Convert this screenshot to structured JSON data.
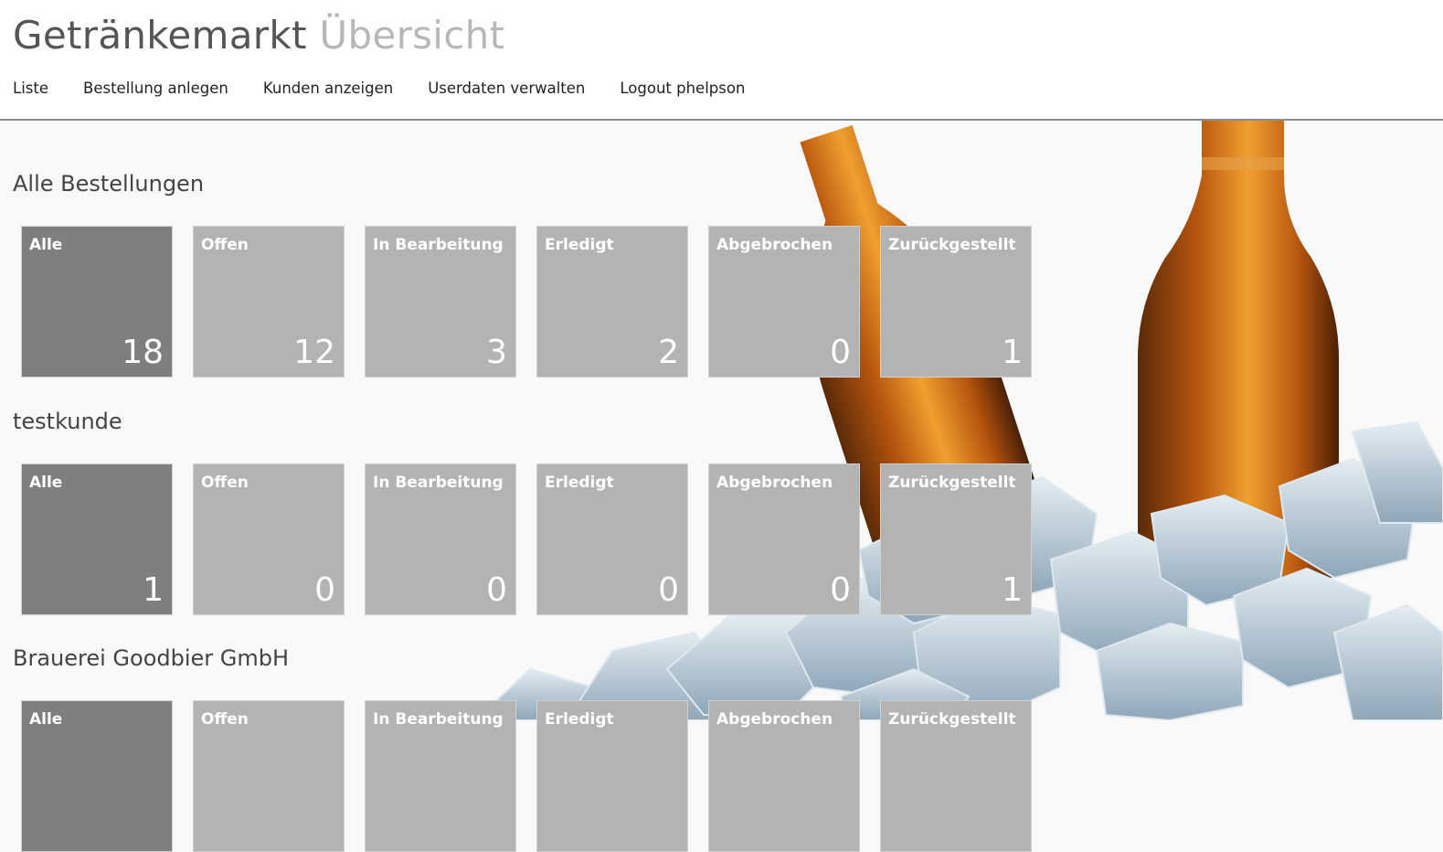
{
  "header": {
    "title_main": "Getränkemarkt",
    "title_sub": "Übersicht",
    "nav": [
      "Liste",
      "Bestellung anlegen",
      "Kunden anzeigen",
      "Userdaten verwalten",
      "Logout phelpson"
    ]
  },
  "sections": [
    {
      "title": "Alle Bestellungen",
      "tiles": [
        {
          "label": "Alle",
          "count": "18"
        },
        {
          "label": "Offen",
          "count": "12"
        },
        {
          "label": "In Bearbeitung",
          "count": "3"
        },
        {
          "label": "Erledigt",
          "count": "2"
        },
        {
          "label": "Abgebrochen",
          "count": "0"
        },
        {
          "label": "Zurückgestellt",
          "count": "1"
        }
      ]
    },
    {
      "title": "testkunde",
      "tiles": [
        {
          "label": "Alle",
          "count": "1"
        },
        {
          "label": "Offen",
          "count": "0"
        },
        {
          "label": "In Bearbeitung",
          "count": "0"
        },
        {
          "label": "Erledigt",
          "count": "0"
        },
        {
          "label": "Abgebrochen",
          "count": "0"
        },
        {
          "label": "Zurückgestellt",
          "count": "1"
        }
      ]
    },
    {
      "title": "Brauerei Goodbier GmbH",
      "tiles": [
        {
          "label": "Alle",
          "count": ""
        },
        {
          "label": "Offen",
          "count": ""
        },
        {
          "label": "In Bearbeitung",
          "count": ""
        },
        {
          "label": "Erledigt",
          "count": ""
        },
        {
          "label": "Abgebrochen",
          "count": ""
        },
        {
          "label": "Zurückgestellt",
          "count": ""
        }
      ]
    }
  ],
  "colors": {
    "tile_active": "#7f7f7f",
    "tile_default": "#b3b3b3",
    "bottle": "#c8620f",
    "ice": "#b9cad6"
  }
}
